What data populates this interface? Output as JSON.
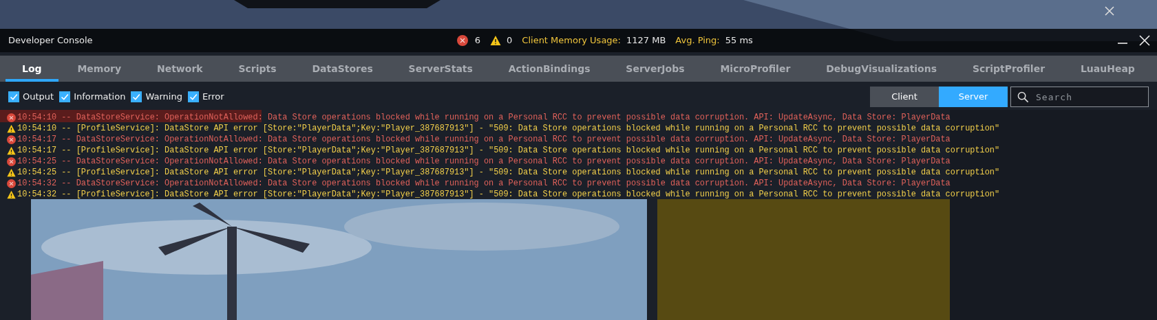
{
  "window": {
    "title": "Developer Console"
  },
  "stats": {
    "errors": "6",
    "warnings": "0",
    "memory_label": "Client Memory Usage:",
    "memory_value": "1127 MB",
    "ping_label": "Avg. Ping:",
    "ping_value": "55 ms"
  },
  "tabs": [
    {
      "label": "Log",
      "selected": true
    },
    {
      "label": "Memory",
      "selected": false
    },
    {
      "label": "Network",
      "selected": false
    },
    {
      "label": "Scripts",
      "selected": false
    },
    {
      "label": "DataStores",
      "selected": false
    },
    {
      "label": "ServerStats",
      "selected": false
    },
    {
      "label": "ActionBindings",
      "selected": false
    },
    {
      "label": "ServerJobs",
      "selected": false
    },
    {
      "label": "MicroProfiler",
      "selected": false
    },
    {
      "label": "DebugVisualizations",
      "selected": false
    },
    {
      "label": "ScriptProfiler",
      "selected": false
    },
    {
      "label": "LuauHeap",
      "selected": false
    }
  ],
  "filters": [
    {
      "label": "Output",
      "checked": true
    },
    {
      "label": "Information",
      "checked": true
    },
    {
      "label": "Warning",
      "checked": true
    },
    {
      "label": "Error",
      "checked": true
    }
  ],
  "source_toggle": [
    {
      "label": "Client",
      "selected": false
    },
    {
      "label": "Server",
      "selected": true
    }
  ],
  "search": {
    "placeholder": "Search"
  },
  "log": [
    {
      "kind": "error",
      "text": "10:54:10 -- DataStoreService: OperationNotAllowed: Data Store operations blocked while running on a Personal RCC to prevent possible data corruption. API: UpdateAsync, Data Store: PlayerData"
    },
    {
      "kind": "warning",
      "text": "10:54:10 -- [ProfileService]: DataStore API error [Store:\"PlayerData\";Key:\"Player_387687913\"] - \"509: Data Store operations blocked while running on a Personal RCC to prevent possible data corruption\""
    },
    {
      "kind": "error",
      "text": "10:54:17 -- DataStoreService: OperationNotAllowed: Data Store operations blocked while running on a Personal RCC to prevent possible data corruption. API: UpdateAsync, Data Store: PlayerData"
    },
    {
      "kind": "warning",
      "text": "10:54:17 -- [ProfileService]: DataStore API error [Store:\"PlayerData\";Key:\"Player_387687913\"] - \"509: Data Store operations blocked while running on a Personal RCC to prevent possible data corruption\""
    },
    {
      "kind": "error",
      "text": "10:54:25 -- DataStoreService: OperationNotAllowed: Data Store operations blocked while running on a Personal RCC to prevent possible data corruption. API: UpdateAsync, Data Store: PlayerData"
    },
    {
      "kind": "warning",
      "text": "10:54:25 -- [ProfileService]: DataStore API error [Store:\"PlayerData\";Key:\"Player_387687913\"] - \"509: Data Store operations blocked while running on a Personal RCC to prevent possible data corruption\""
    },
    {
      "kind": "error",
      "text": "10:54:32 -- DataStoreService: OperationNotAllowed: Data Store operations blocked while running on a Personal RCC to prevent possible data corruption. API: UpdateAsync, Data Store: PlayerData"
    },
    {
      "kind": "warning",
      "text": "10:54:32 -- [ProfileService]: DataStore API error [Store:\"PlayerData\";Key:\"Player_387687913\"] - \"509: Data Store operations blocked while running on a Personal RCC to prevent possible data corruption\""
    }
  ]
}
